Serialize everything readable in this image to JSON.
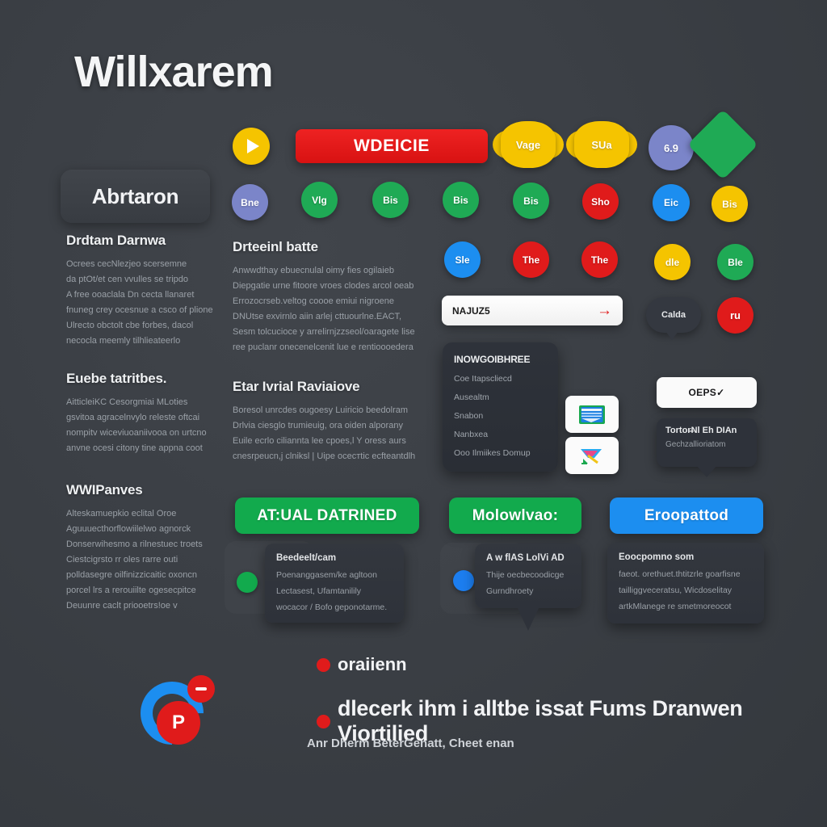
{
  "app": {
    "title": "Willxarem",
    "background": "#3b3f45"
  },
  "sidebar": {
    "pill_label": "Abrtaron",
    "sections": [
      {
        "heading": "Drdtam Darnwa",
        "lines": [
          "Ocrees cecNlezjeo scersemne",
          "da ptOt/et cen vvulles se tripdo",
          "A free ooaclala Dn cecta llanaret",
          "fnuneg crey ocesnue a csco of plione",
          "Ulrecto obctolt cbe forbes, dacol",
          "necocla meemly tilhlieateerlo"
        ]
      },
      {
        "heading": "Euebe tatritbes.",
        "lines": [
          "AitticleiKC Cesorgmiai MLoties",
          "gsvitoa agracelnvylo releste oftcai",
          "nompitv wiceviuoaniivooa on urtcno",
          "anvne ocesi citony tine appna coot"
        ]
      },
      {
        "heading": "WWIPanves",
        "lines": [
          "Alteskamuepkio eclital Oroe",
          "Aguuuecthorflowiilelwo agnorck",
          "Donserwihesmo a rilnestuec troets",
          "Ciestcigrsto rr oles rarre outi",
          "polldasegre oilfinizzicaitic oxoncn",
          "porcel lrs a rerouiilte ogesecpitce",
          "Deuunre caclt priooetrs!oe v"
        ]
      }
    ]
  },
  "middle_column": {
    "sections": [
      {
        "heading": "Drteeinl batte",
        "lines": [
          "Anwwdthay ebuecnulal oimy fies ogilaieb",
          "Diepgatie urne fitoore vroes clodes arcol oeab",
          "Errozocrseb.veltog coooe emiui nigroene",
          "DNUtse exvirnlo aiin arlej cttuourlne.EACT,",
          "Sesm tolcucioce y arrelirnjzzseol/oaragete lise",
          "ree puclanr onecenelcenit lue e rentioooedera"
        ]
      },
      {
        "heading": "Etar Ivrial Raviaiove",
        "lines": [
          "Boresol unrcdes ougoesy Luiricio beedolram",
          "Drlvia ciesglo trumieuig, ora oiden alporany",
          "Euile ecrlo ciliannta lee cpoes,l Y oress aurs",
          "cnesrpeucn,j clniksl | Uipe ocecтtic ecfteantdlh"
        ]
      }
    ]
  },
  "chips": {
    "play_label": "play",
    "primary_cta": "WDEICIE",
    "row1": [
      {
        "label": "Vage",
        "color": "#f5c400",
        "shape": "flower"
      },
      {
        "label": "SUa",
        "color": "#f5c400",
        "shape": "flower"
      },
      {
        "label": "6.9",
        "color": "#7b85c9",
        "shape": "circle"
      },
      {
        "label": "",
        "color": "#1faa55",
        "shape": "diamond",
        "glyph": "minus"
      }
    ],
    "row2": [
      {
        "label": "Bne",
        "color": "#7b85c9",
        "shape": "circle"
      },
      {
        "label": "Vlg",
        "color": "#1faa55",
        "shape": "circle"
      },
      {
        "label": "Bis",
        "color": "#1faa55",
        "shape": "circle"
      },
      {
        "label": "Bis",
        "color": "#1faa55",
        "shape": "circle"
      },
      {
        "label": "Bis",
        "color": "#1faa55",
        "shape": "circle"
      },
      {
        "label": "Sho",
        "color": "#e01b1b",
        "shape": "circle"
      },
      {
        "label": "Eic",
        "color": "#1c8ef0",
        "shape": "circle"
      },
      {
        "label": "Bis",
        "color": "#f5c400",
        "shape": "circle"
      }
    ],
    "row3": [
      {
        "label": "Sle",
        "color": "#1c8ef0",
        "shape": "circle"
      },
      {
        "label": "The",
        "color": "#e01b1b",
        "shape": "circle"
      },
      {
        "label": "The",
        "color": "#e01b1b",
        "shape": "circle"
      },
      {
        "label": "dle",
        "color": "#f5c400",
        "shape": "circle"
      },
      {
        "label": "Ble",
        "color": "#1faa55",
        "shape": "circle"
      }
    ],
    "loose": [
      {
        "label": "ru",
        "color": "#e01b1b",
        "shape": "circle"
      }
    ]
  },
  "search": {
    "value": "NAJUZ5",
    "arrow_icon": "→"
  },
  "dropdown": {
    "heading": "INOWGOIBHREE",
    "items": [
      "Coe Itapscliecd",
      "Ausealtm",
      "Snabon",
      "Nanbxea",
      "Ooo Ilmiikes Domup"
    ]
  },
  "icon_tiles": [
    {
      "name": "document-icon"
    },
    {
      "name": "chart-icon"
    }
  ],
  "tooltip": {
    "chip_label": "OEPS✓",
    "title": "Tortor̶Nl Eh DIAn",
    "subtitle": "Gechzallioriatom"
  },
  "calda": {
    "label": "Calda"
  },
  "cards": [
    {
      "header": "AT:UAL DATRINED",
      "header_color": "#12aa4d",
      "dot_color": "#12aa4d",
      "lines": [
        "Beedeelt/cam",
        "Poenanggasem/ke agltoon",
        "Lectasest,   Ufamtanilily",
        "wocacor / Bofo geponotarme."
      ]
    },
    {
      "header": "Molowlvao:",
      "header_color": "#12aa4d",
      "dot_color": "#1c7ef0",
      "lines": [
        "A w  flAS  LolVi AD",
        "Thije oecbecoodicge",
        "Gurndhroety"
      ]
    },
    {
      "header": "Eroopattod",
      "header_color": "#1c8ef0",
      "dot_color": "#1c8ef0",
      "lines": [
        "Eoocpomno som",
        "faeot. orethuet.thtitzrle goarfisne",
        "tailliggveceratsu, Wicdoselitay",
        "artkMlanege re smetmoreocot"
      ]
    }
  ],
  "footer": {
    "logo_glyph": "P",
    "kicker": "oraiienn",
    "headline": "dlecerk ihm i alltbe issat Fums Dranwen Viortilied",
    "subtitle": "Anr Dherm BeterGenatt, Cheet enan"
  }
}
